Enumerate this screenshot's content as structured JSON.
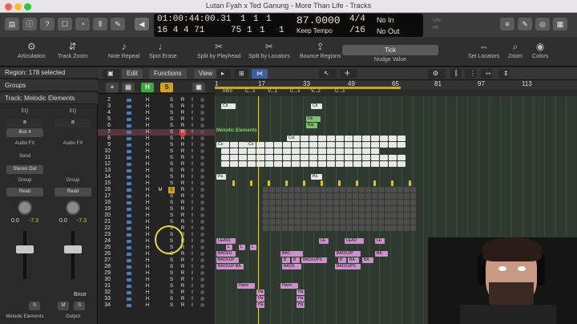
{
  "window": {
    "title": "Lutan Fyah x Ted Ganung - More Than Life - Tracks"
  },
  "lcd": {
    "time": "01:00:44:00.31",
    "time_extra": [
      "1",
      "1",
      "1"
    ],
    "bars": "16  4  4  71",
    "bars_extra": [
      "75",
      "1",
      "1",
      "1"
    ],
    "tempo": "87.0000",
    "tempo_mode": "Keep Tempo",
    "sig": "4/4",
    "division": "/16",
    "in": "No In",
    "out": "No Out"
  },
  "toolbar": {
    "items": [
      {
        "label": "Articulation",
        "icon": "articulation-icon"
      },
      {
        "label": "Track Zoom",
        "icon": "track-zoom-icon"
      },
      {
        "label": "Note Repeat",
        "icon": "note-repeat-icon"
      },
      {
        "label": "Spot Erase",
        "icon": "spot-erase-icon"
      },
      {
        "label": "Split by Playhead",
        "icon": "split-playhead-icon"
      },
      {
        "label": "Split by Locators",
        "icon": "split-locators-icon"
      },
      {
        "label": "Bounce Regions",
        "icon": "bounce-regions-icon"
      },
      {
        "label": "Set Locators",
        "icon": "set-locators-icon"
      },
      {
        "label": "Zoom",
        "icon": "zoom-icon"
      },
      {
        "label": "Colors",
        "icon": "colors-icon"
      }
    ],
    "nudge_value": "Tick",
    "nudge_label": "Nudge Value"
  },
  "inspector": {
    "region": "Region: 178 selected",
    "groups": "Groups",
    "track": "Track:  Melodic Elements",
    "left_strip": {
      "eq": "EQ",
      "input": "Bus 4",
      "audio_fx": "Audio FX",
      "send": "Send",
      "output": "Stereo Out",
      "group": "Group",
      "automation": "Read",
      "vol": "0.0",
      "pan": "-7.3",
      "name": "Melodic Elements",
      "s": "S"
    },
    "right_strip": {
      "eq": "EQ",
      "audio_fx": "Audio FX",
      "group": "Group",
      "automation": "Read",
      "vol": "0.0",
      "pan": "-7.3",
      "name": "Output",
      "m": "M",
      "s": "S",
      "bnce": "Bnce"
    }
  },
  "tracks_menu": {
    "edit": "Edit",
    "functions": "Functions",
    "view": "View"
  },
  "header_buttons": {
    "h": "H",
    "s": "S"
  },
  "ruler": {
    "bars": [
      "1",
      "17",
      "33",
      "49",
      "65",
      "81",
      "97",
      "113"
    ]
  },
  "markers": [
    "Intro",
    "C...s",
    "V...1",
    "C...s",
    "V...2",
    "C...s"
  ],
  "track_numbers": [
    "2",
    "3",
    "4",
    "5",
    "6",
    "7",
    "8",
    "9",
    "10",
    "11",
    "12",
    "13",
    "14",
    "15",
    "16",
    "17",
    "18",
    "19",
    "20",
    "21",
    "22",
    "23",
    "24",
    "25",
    "26",
    "27",
    "28",
    "29",
    "30",
    "31",
    "32",
    "33",
    "34"
  ],
  "region_labels": {
    "melodic": "Melodic Elements",
    "clt": "Clt",
    "do": "Do",
    "rai": "Rai",
    "co1": "Co",
    "co2": "Co",
    "col": "Col",
    "pa1": "Pa",
    "pa2": "Pa",
    "lead1": "LEAD1",
    "le1": "LE",
    "lead": "LEAD",
    "le2": "LE",
    "l": "L",
    "backu": "BACKU",
    "bac": "BAC",
    "backup": "BACKUP",
    "ba": "BA",
    "b": "B",
    "backups": "BACKUPS",
    "backup_ba": "BACKUP BA",
    "back": "BACK",
    "harm": "Harm",
    "ha": "Ha"
  }
}
